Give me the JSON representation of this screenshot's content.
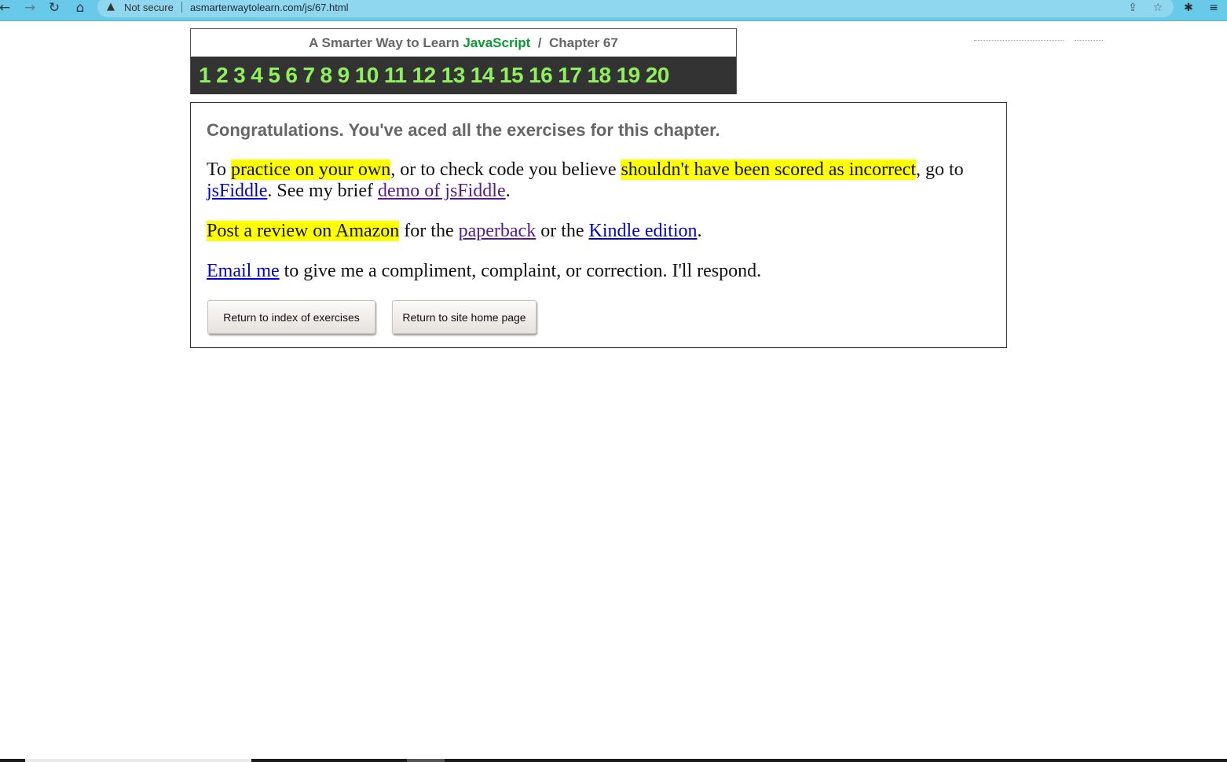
{
  "browser": {
    "back_icon": "←",
    "forward_icon": "→",
    "reload_icon": "↻",
    "home_icon": "⌂",
    "warning_icon": "▲",
    "security_label": "Not secure",
    "url": "asmarterwaytolearn.com/js/67.html",
    "share_icon": "⇪",
    "star_icon": "☆",
    "extensions_icon": "✱",
    "reading_list_icon": "≡"
  },
  "header": {
    "title_prefix": "A Smarter Way to Learn ",
    "title_accent": "JavaScript",
    "title_suffix": "  /  Chapter 67",
    "exercise_numbers": [
      "1",
      "2",
      "3",
      "4",
      "5",
      "6",
      "7",
      "8",
      "9",
      "10",
      "11",
      "12",
      "13",
      "14",
      "15",
      "16",
      "17",
      "18",
      "19",
      "20"
    ]
  },
  "content": {
    "congrats": "Congratulations. You've aced all the exercises for this chapter.",
    "p1": {
      "t1": "To ",
      "hl1": "practice on your own",
      "t2": ", or to check code you believe ",
      "hl2": "shouldn't have been scored as incorrect",
      "t3": ", go to ",
      "link_jsfiddle": "jsFiddle",
      "t4": ". See my brief ",
      "link_demo": "demo of jsFiddle",
      "t5": "."
    },
    "p2": {
      "hl": "Post a review on Amazon",
      "t1": " for the ",
      "link_paperback": "paperback",
      "t2": " or the ",
      "link_kindle": "Kindle edition",
      "t3": "."
    },
    "p3": {
      "link_email": "Email me",
      "t1": " to give me a compliment, complaint, or correction. I'll respond."
    },
    "buttons": {
      "index": "Return to index of exercises",
      "home": "Return to site home page"
    }
  },
  "colors": {
    "browser_bar": "#69c9e9",
    "number_bar": "#333333",
    "numbers": "#8ef05a",
    "javascript_accent": "#0a9a33",
    "highlight": "#ffff00"
  }
}
